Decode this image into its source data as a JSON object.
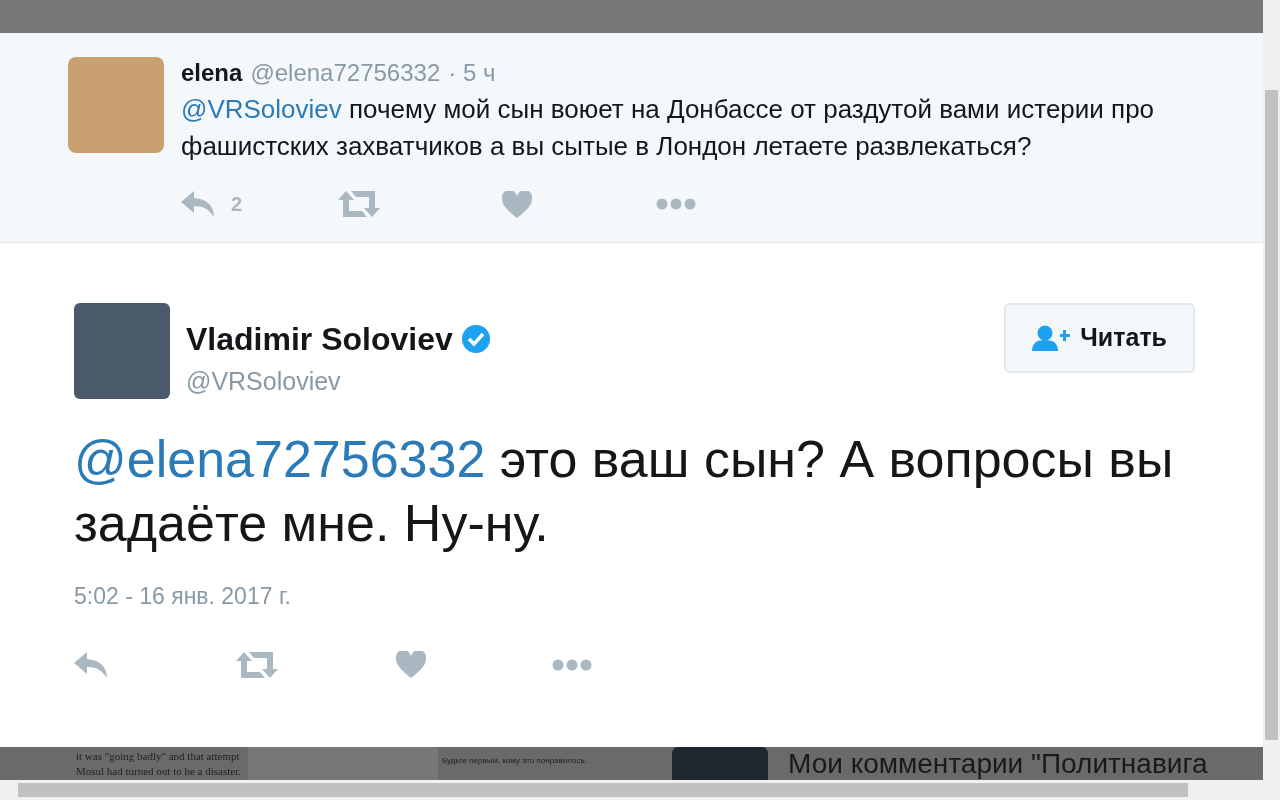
{
  "parent_tweet": {
    "name": "elena",
    "handle": "@elena72756332",
    "time": "· 5 ч",
    "mention": "@VRSoloviev",
    "text": "почему мой сын воюет на Донбассе от раздутой вами истерии про фашистских захватчиков а вы сытые в Лондон летаете развлекаться?",
    "reply_count": "2"
  },
  "tweet": {
    "name": "Vladimir Soloviev",
    "verified": true,
    "handle": "@VRSoloviev",
    "follow_button": "Читать",
    "mention": "@elena72756332",
    "text": "это ваш сын? А вопросы вы задаёте мне. Ну-ну.",
    "timestamp": "5:02 - 16 янв. 2017 г."
  },
  "background_texts": [
    "it was \"going badly\" and that attempt",
    "Mosul had turned out to be a disaster.",
    "Будьте первым, кому это понравилось.",
    "Мои комментарии \"Политнавига"
  ]
}
